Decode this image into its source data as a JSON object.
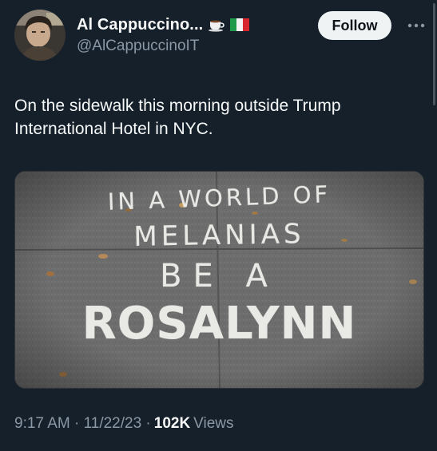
{
  "tweet": {
    "author": {
      "display_name": "Al Cappuccino...",
      "handle": "@AlCappuccinoIT",
      "avatar_icon": "profile-photo",
      "name_emojis": [
        "coffee-cup-icon",
        "italian-flag-icon"
      ]
    },
    "follow_label": "Follow",
    "more_icon": "ellipsis-icon",
    "text": "On the sidewalk this morning outside Trump\nInternational Hotel in NYC.",
    "media": {
      "chalk_lines": [
        "IN A WORLD OF",
        "MELANIAS",
        "BE A",
        "ROSALYNN"
      ]
    },
    "timestamp": "9:17 AM · 11/22/23 · ",
    "views_count": "102K",
    "views_label": " Views"
  },
  "colors": {
    "background": "#15202b",
    "text_primary": "#f7f9f9",
    "text_secondary": "#8b98a5",
    "follow_button_bg": "#eff3f4",
    "follow_button_text": "#0f1419"
  }
}
